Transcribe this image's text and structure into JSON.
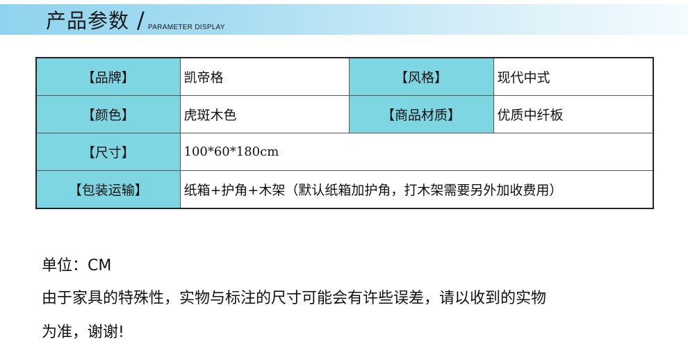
{
  "header": {
    "title": "产品参数",
    "slash": "/",
    "subtitle": "PARAMETER DISPLAY"
  },
  "table": {
    "rows": [
      {
        "label1": "【品牌】",
        "value1": "凯帝格",
        "label2": "【风格】",
        "value2": "现代中式"
      },
      {
        "label1": "【颜色】",
        "value1": "虎斑木色",
        "label2": "【商品材质】",
        "value2": "优质中纤板"
      },
      {
        "label1": "【尺寸】",
        "value1": "100*60*180cm"
      },
      {
        "label1": "【包装运输】",
        "value1": "纸箱+护角+木架（默认纸箱加护角，打木架需要另外加收费用）"
      }
    ]
  },
  "notes": {
    "unit": "单位：CM",
    "line1": "由于家具的特殊性，实物与标注的尺寸可能会有许些误差，请以收到的实物",
    "line2": "为准，谢谢!"
  },
  "colors": {
    "label_cell": "#7fd6e3",
    "banner": "#8fd3ee"
  }
}
